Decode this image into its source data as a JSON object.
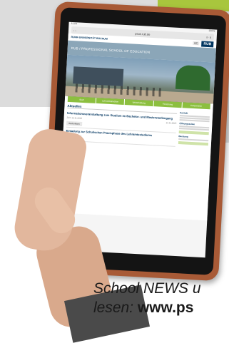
{
  "tablet": {
    "status_time": "11:04",
    "status_battery": "100%",
    "url": "psoe.rub.de",
    "university_name": "RUHR-UNIVERSITÄT BOCHUM",
    "logo": "RUB",
    "badge": "SC",
    "header_title": "RUB / PROFESSIONAL SCHOOL OF EDUCATION",
    "green_tabs": [
      "Start",
      "Lehramtsstudium",
      "Weiterbildung",
      "Forschung",
      "Kooperation"
    ],
    "section_title": "Aktuelles",
    "news": [
      {
        "headline": "Informationsveranstaltung zum Studium im Bachelor- und Masterstudiengang",
        "date_left": "Zeit: 12.11.2015",
        "date_right": "12.11.2015",
        "button": "Weiterlesen"
      },
      {
        "headline": "Einladung zur Schulischen Praxisphase des Lehramtsstudiums",
        "date_left": "",
        "date_right": "",
        "button": "Weiterlesen"
      }
    ],
    "sidebar_titles": [
      "Kontakt",
      "Öffnungszeiten",
      "Beratung"
    ]
  },
  "caption": {
    "line1": "School NEWS u",
    "line2_prefix": "lesen: ",
    "line2_bold": "www.ps"
  }
}
